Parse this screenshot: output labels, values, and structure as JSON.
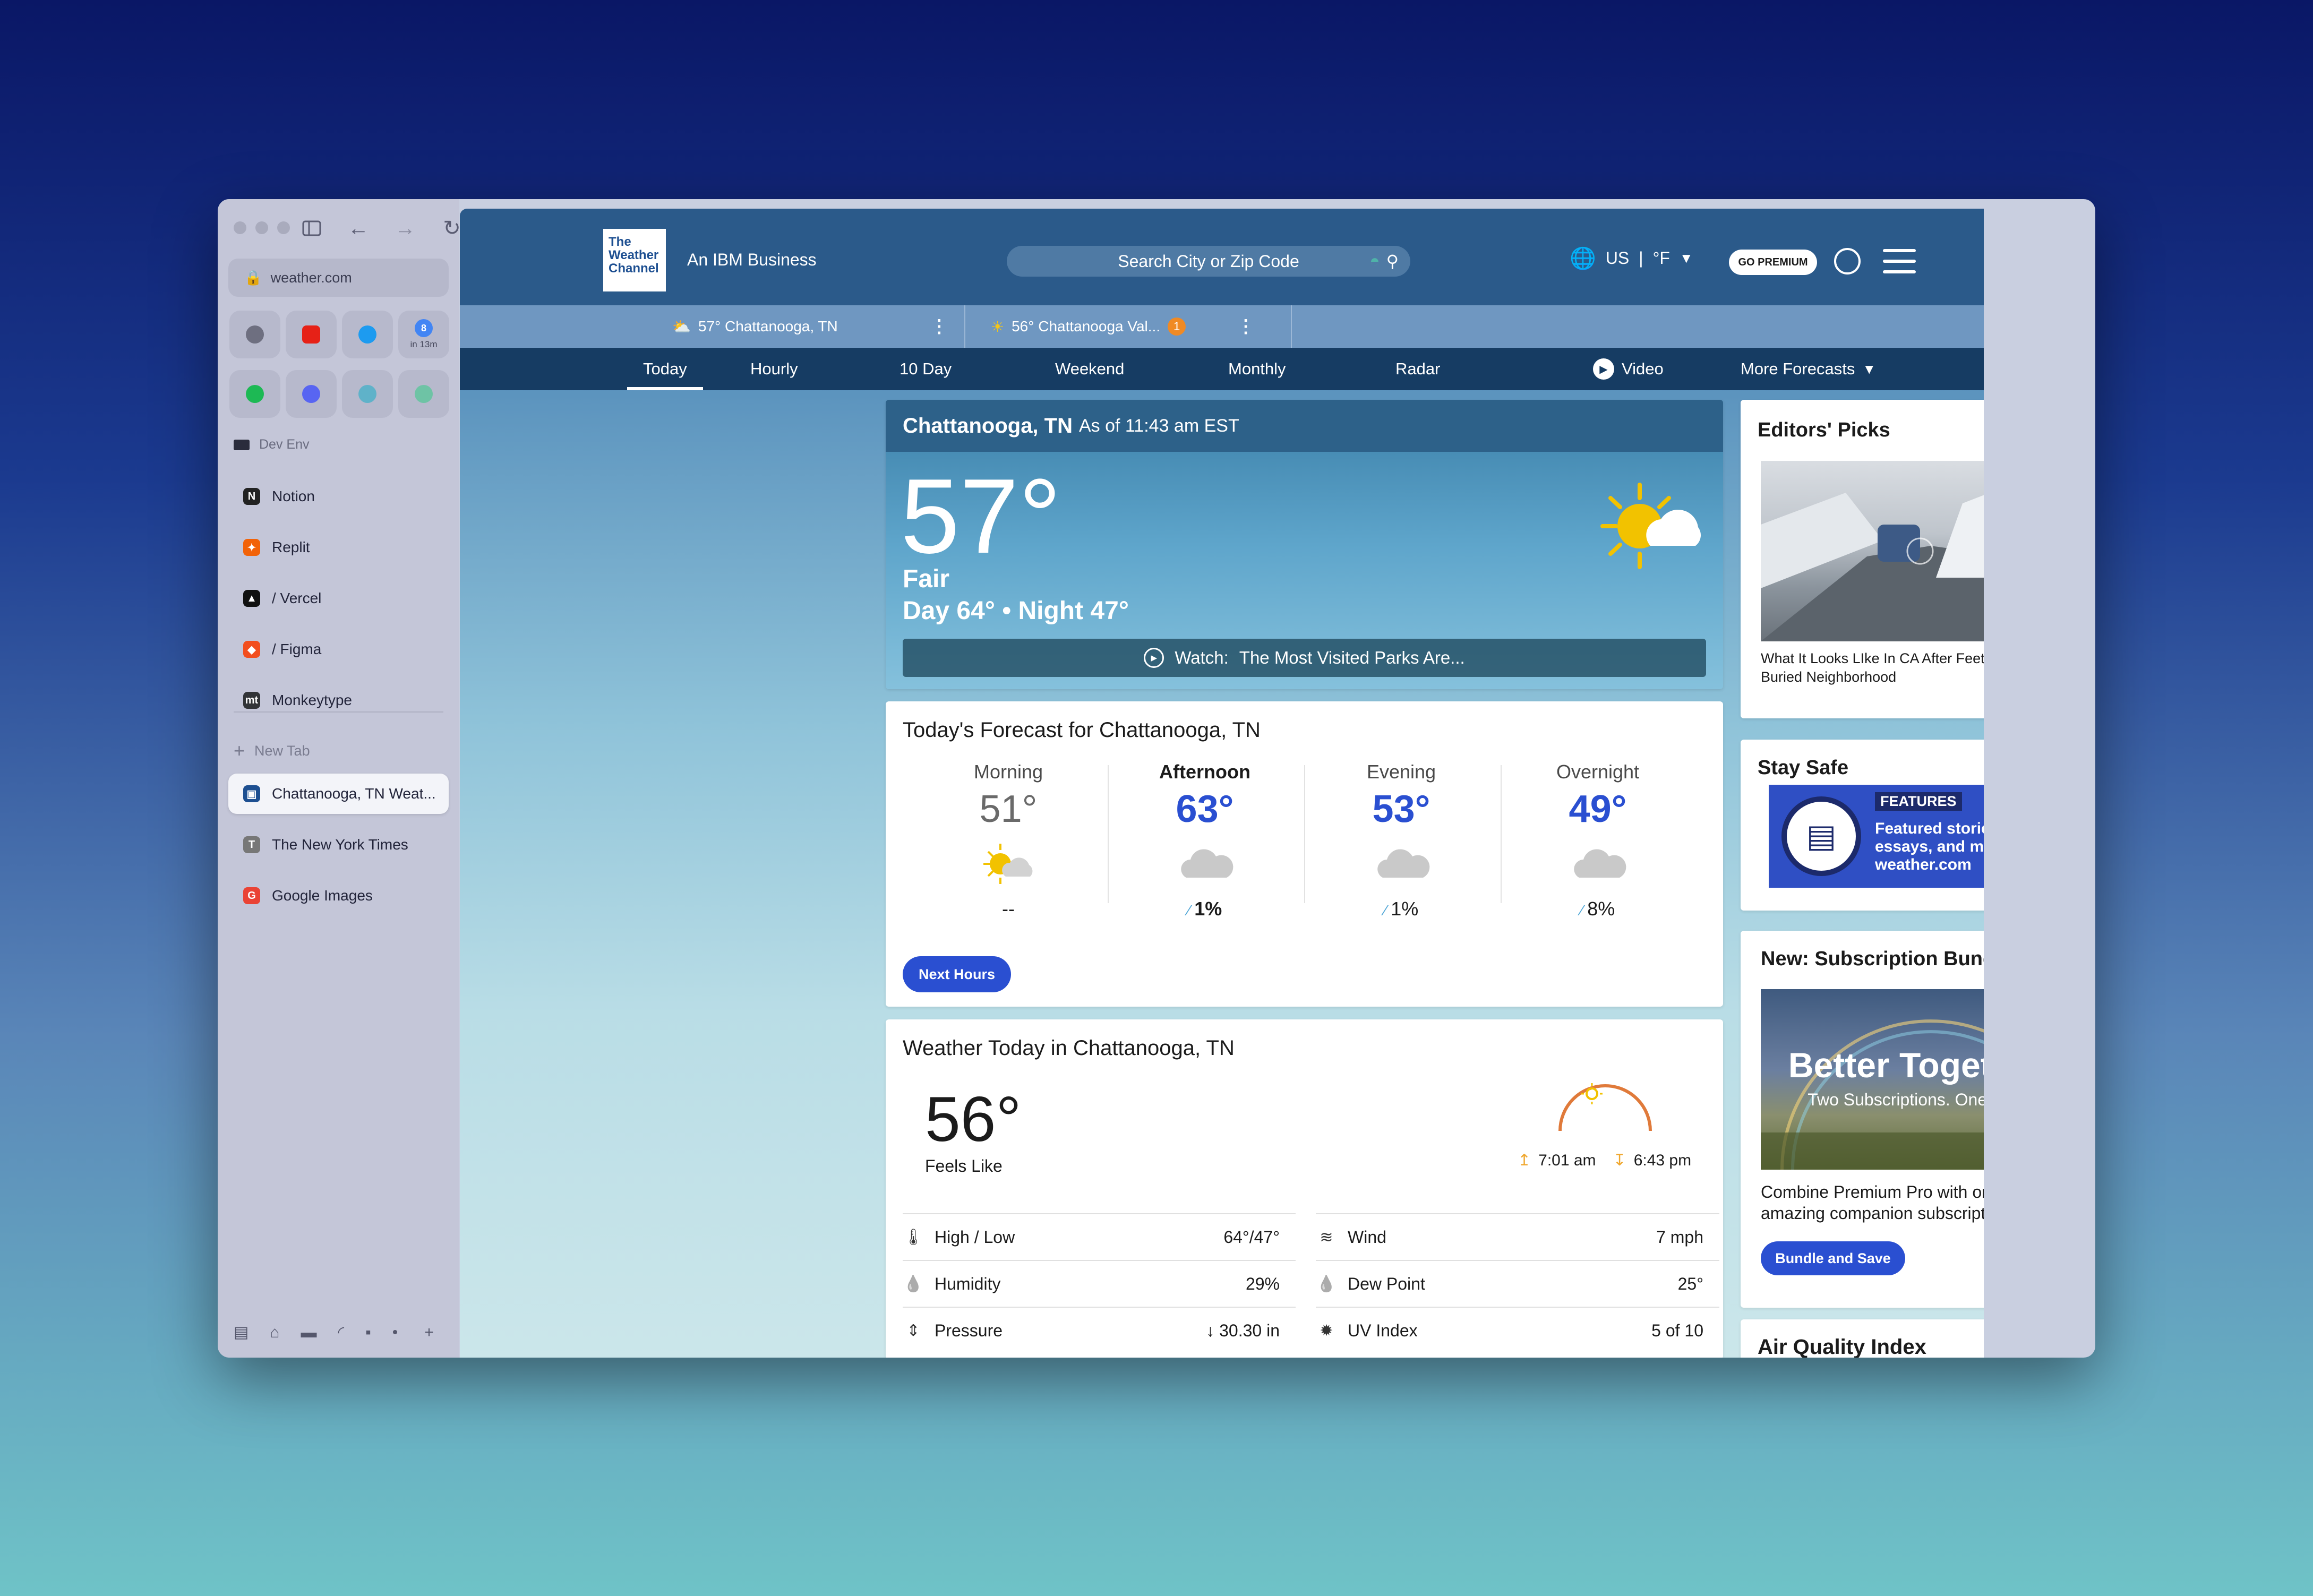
{
  "browser": {
    "url": "weather.com",
    "pins": [
      {
        "name": "github",
        "color": "#6e6f80",
        "sub": ""
      },
      {
        "name": "youtube",
        "color": "#e62117",
        "sub": ""
      },
      {
        "name": "twitter",
        "color": "#1d9bf0",
        "sub": ""
      },
      {
        "name": "calendar",
        "color": "#4285f4",
        "sub": "in 13m",
        "icon_text": "8"
      },
      {
        "name": "spotify",
        "color": "#1db954",
        "sub": ""
      },
      {
        "name": "discord",
        "color": "#5865f2",
        "sub": ""
      },
      {
        "name": "arc",
        "color": "#5fb2c9",
        "sub": ""
      },
      {
        "name": "chatgpt",
        "color": "#6ec3a5",
        "sub": ""
      }
    ],
    "section_label": "Dev Env",
    "folder_items": [
      {
        "label": "Notion",
        "icon_text": "N",
        "color": "#222"
      },
      {
        "label": "Replit",
        "icon_text": "✦",
        "color": "#f26207"
      },
      {
        "label": "/ Vercel",
        "icon_text": "▲",
        "color": "#111"
      },
      {
        "label": "/ Figma",
        "icon_text": "◆",
        "color": "#f24e1e"
      },
      {
        "label": "Monkeytype",
        "icon_text": "mt",
        "color": "#323437"
      }
    ],
    "new_tab_label": "New Tab",
    "tabs": [
      {
        "label": "Chattanooga, TN Weat...",
        "icon_text": "▣",
        "color": "#1d4f91",
        "active": true
      },
      {
        "label": "The New York Times",
        "icon_text": "T",
        "color": "#777",
        "active": false
      },
      {
        "label": "Google Images",
        "icon_text": "G",
        "color": "#ea4335",
        "active": false
      }
    ]
  },
  "header": {
    "logo_lines": [
      "The",
      "Weather",
      "Channel"
    ],
    "tagline": "An IBM Business",
    "search_placeholder": "Search City or Zip Code",
    "locale_country": "US",
    "locale_unit": "°F",
    "premium_label": "GO PREMIUM"
  },
  "recent_locations": [
    {
      "label": "57° Chattanooga, TN",
      "badge": ""
    },
    {
      "label": "56° Chattanooga Val...",
      "badge": "1"
    }
  ],
  "nav": [
    "Today",
    "Hourly",
    "10 Day",
    "Weekend",
    "Monthly",
    "Radar",
    "Video",
    "More Forecasts"
  ],
  "current": {
    "location": "Chattanooga, TN",
    "as_of": "As of 11:43 am EST",
    "temp": "57°",
    "condition": "Fair",
    "day_night": "Day 64° • Night 47°",
    "watch_prefix": "Watch:",
    "watch_title": "The Most Visited Parks Are..."
  },
  "todays_forecast": {
    "title": "Today's Forecast for Chattanooga, TN",
    "periods": [
      {
        "label": "Morning",
        "temp": "51°",
        "precip": "--",
        "icon": "partly-sunny-icon"
      },
      {
        "label": "Afternoon",
        "temp": "63°",
        "precip": "1%",
        "icon": "cloud-icon"
      },
      {
        "label": "Evening",
        "temp": "53°",
        "precip": "1%",
        "icon": "cloud-icon"
      },
      {
        "label": "Overnight",
        "temp": "49°",
        "precip": "8%",
        "icon": "cloud-icon"
      }
    ],
    "button": "Next Hours"
  },
  "weather_today": {
    "title": "Weather Today in Chattanooga, TN",
    "feels_temp": "56°",
    "feels_label": "Feels Like",
    "sunrise": "7:01 am",
    "sunset": "6:43 pm",
    "metrics_left": [
      {
        "label": "High / Low",
        "value": "64°/47°",
        "icon": "thermometer-icon"
      },
      {
        "label": "Humidity",
        "value": "29%",
        "icon": "humidity-icon"
      },
      {
        "label": "Pressure",
        "value": "↓ 30.30 in",
        "icon": "pressure-icon"
      }
    ],
    "metrics_right": [
      {
        "label": "Wind",
        "value": "7 mph",
        "icon": "wind-icon"
      },
      {
        "label": "Dew Point",
        "value": "25°",
        "icon": "dew-point-icon"
      },
      {
        "label": "UV Index",
        "value": "5 of 10",
        "icon": "uv-index-icon"
      }
    ]
  },
  "editors_picks": {
    "title": "Editors' Picks",
    "caption": "What It Looks LIke In CA After Feet Of Snow Buried Neighborhood"
  },
  "stay_safe": {
    "title": "Stay Safe",
    "tag": "FEATURES",
    "text": "Featured stories, photo essays, and more by weather.com"
  },
  "subscription": {
    "title": "New: Subscription Bundle",
    "headline": "Better Together.",
    "subline": "Two Subscriptions. One Price.",
    "body": "Combine Premium Pro with one of our amazing companion subscriptions.",
    "button": "Bundle and Save"
  },
  "air_quality": {
    "title": "Air Quality Index"
  }
}
